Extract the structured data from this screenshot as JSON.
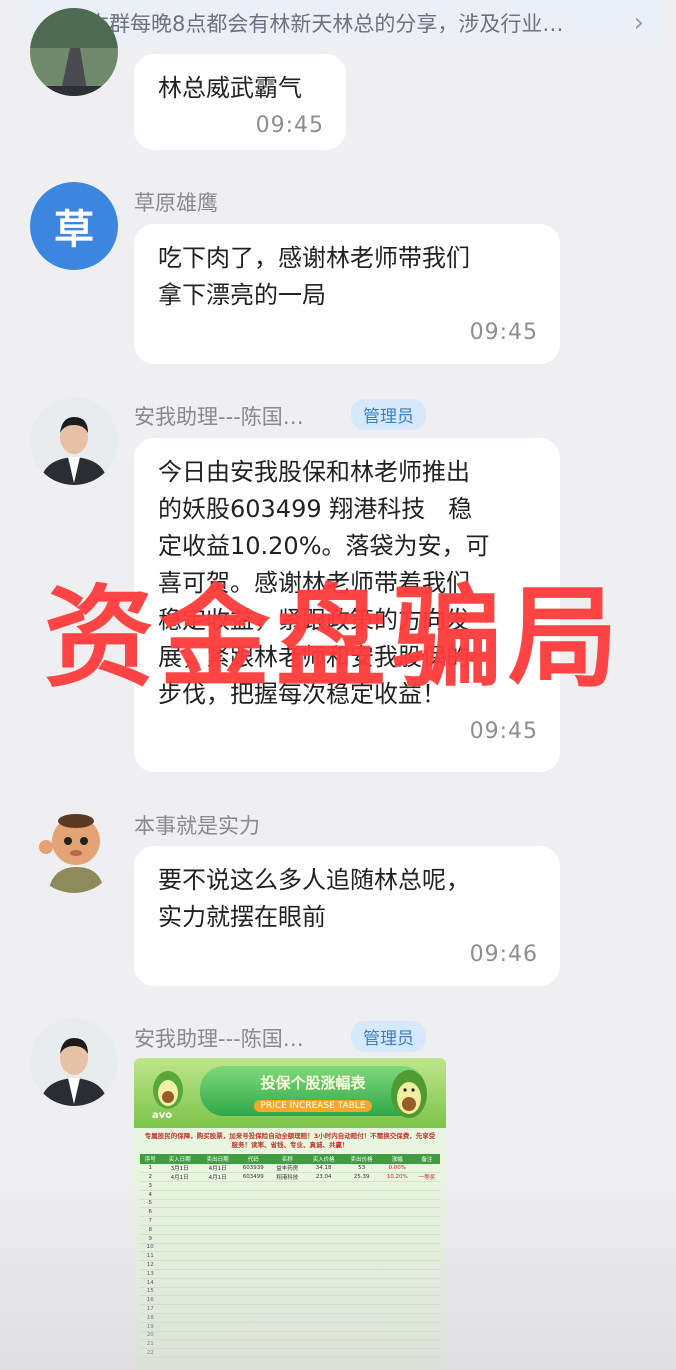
{
  "notice": {
    "text": "本群每晚8点都会有林新天林总的分享，涉及行业…",
    "icon": "speaker-icon",
    "chevron": "chevron-right-icon"
  },
  "watermark": "资金盘骗局",
  "messages": [
    {
      "sender": "",
      "text": "林总威武霸气",
      "time": "09:45"
    },
    {
      "sender": "草原雄鹰",
      "avatar_text": "草",
      "avatar_color": "#3d86e0",
      "text": "吃下肉了，感谢林老师带我们\n拿下漂亮的一局",
      "time": "09:45"
    },
    {
      "sender": "安我助理---陈国…",
      "badge": "管理员",
      "text": "今日由安我股保和林老师推出\n的妖股603499 翔港科技   稳\n定收益10.20%。落袋为安，可\n喜可贺。感谢林老师带着我们\n稳定收益，紧跟政策的方向发\n展，紧跟林老师和安我股保的\n步伐，把握每次稳定收益！",
      "time": "09:45"
    },
    {
      "sender": "本事就是实力",
      "text": "要不说这么多人追随林总呢，\n实力就摆在眼前",
      "time": "09:46"
    },
    {
      "sender": "安我助理---陈国…",
      "badge": "管理员"
    }
  ],
  "poster": {
    "logo": "avo",
    "title": "投保个股涨幅表",
    "subtitle": "PRICE INCREASE TABLE",
    "intro": "专属股民的保障，购买股票，加来号投保险自动全额理赔！3小时内自动赔付！不需换交保费，先享受服务！读率、省钱、专业、真诚、共赢！",
    "headers": [
      "序号",
      "买入日期",
      "卖出日期",
      "代码",
      "名称",
      "买入价格",
      "卖出价格",
      "涨幅",
      "备注"
    ],
    "rows": [
      [
        "1",
        "3月1日",
        "4月1日",
        "603939",
        "益丰药房",
        "34.18",
        "53",
        "0.00%",
        ""
      ],
      [
        "2",
        "4月1日",
        "4月1日",
        "603499",
        "翔港科技",
        "23.04",
        "25.39",
        "10.20%",
        "一等奖"
      ]
    ],
    "empty_rows": [
      "3",
      "4",
      "5",
      "6",
      "7",
      "8",
      "9",
      "10",
      "11",
      "12",
      "13",
      "14",
      "15",
      "16",
      "17",
      "18",
      "19",
      "20",
      "21",
      "22"
    ]
  }
}
